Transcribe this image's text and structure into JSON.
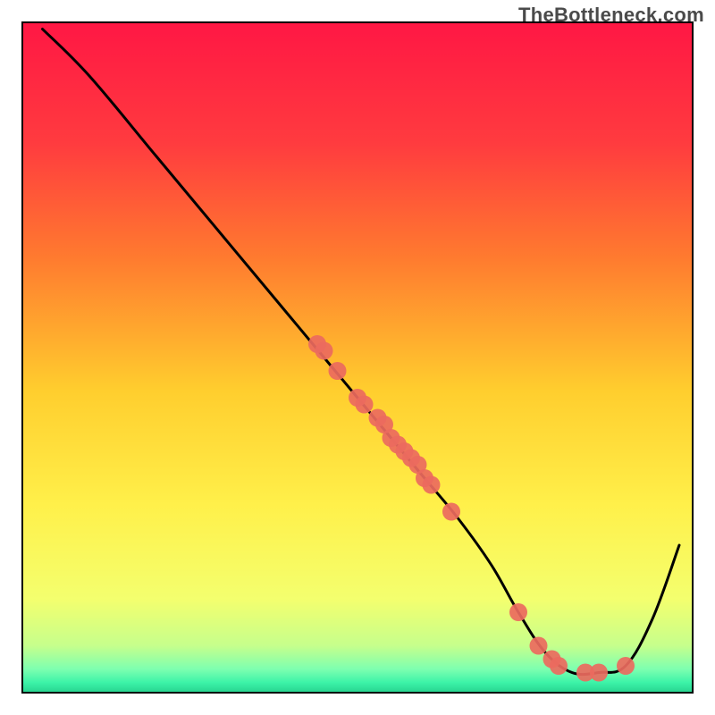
{
  "watermark": "TheBottleneck.com",
  "chart_data": {
    "type": "line",
    "title": "",
    "xlabel": "",
    "ylabel": "",
    "xlim": [
      0,
      100
    ],
    "ylim": [
      0,
      100
    ],
    "grid": false,
    "legend": false,
    "background_gradient": {
      "stops": [
        {
          "offset": 0.0,
          "color": "#ff1744"
        },
        {
          "offset": 0.18,
          "color": "#ff3b3f"
        },
        {
          "offset": 0.35,
          "color": "#ff7a2f"
        },
        {
          "offset": 0.55,
          "color": "#ffce2e"
        },
        {
          "offset": 0.72,
          "color": "#fff04a"
        },
        {
          "offset": 0.86,
          "color": "#f4ff6e"
        },
        {
          "offset": 0.93,
          "color": "#c6ff8c"
        },
        {
          "offset": 0.965,
          "color": "#7dffb0"
        },
        {
          "offset": 0.985,
          "color": "#3cf3a8"
        },
        {
          "offset": 1.0,
          "color": "#27d38f"
        }
      ]
    },
    "series": [
      {
        "name": "bottleneck-curve",
        "type": "line",
        "color": "#000000",
        "x": [
          3,
          10,
          20,
          30,
          40,
          50,
          55,
          60,
          65,
          70,
          74,
          78,
          82,
          86,
          90,
          94,
          98
        ],
        "y": [
          99,
          92,
          80,
          68,
          56,
          44,
          38,
          32,
          26,
          19,
          12,
          6,
          3,
          3,
          4,
          11,
          22
        ]
      },
      {
        "name": "highlighted-points",
        "type": "scatter",
        "color": "#ec6a5e",
        "radius": 10,
        "x": [
          44,
          45,
          47,
          50,
          51,
          53,
          54,
          55,
          56,
          57,
          58,
          59,
          60,
          61,
          64,
          74,
          77,
          79,
          80,
          84,
          86,
          90
        ],
        "y": [
          52,
          51,
          48,
          44,
          43,
          41,
          40,
          38,
          37,
          36,
          35,
          34,
          32,
          31,
          27,
          12,
          7,
          5,
          4,
          3,
          3,
          4
        ]
      }
    ]
  }
}
